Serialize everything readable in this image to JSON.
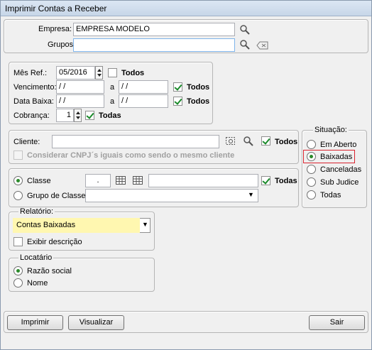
{
  "window": {
    "title": "Imprimir Contas a Receber"
  },
  "empresa": {
    "label": "Empresa:",
    "value": "EMPRESA MODELO"
  },
  "grupos": {
    "label": "Grupos:",
    "value": ""
  },
  "filters": {
    "mes_ref": {
      "label": "Mês Ref.:",
      "value": "05/2016",
      "todos_label": "Todos",
      "todos_checked": false
    },
    "vencimento": {
      "label": "Vencimento:",
      "from": " / /",
      "sep": "a",
      "to": " / /",
      "todos_label": "Todos",
      "todos_checked": true
    },
    "data_baixa": {
      "label": "Data Baixa:",
      "from": " / /",
      "sep": "a",
      "to": " / /",
      "todos_label": "Todos",
      "todos_checked": true
    },
    "cobranca": {
      "label": "Cobrança:",
      "value": "1",
      "todas_label": "Todas",
      "todas_checked": true
    }
  },
  "cliente": {
    "label": "Cliente:",
    "value": "",
    "todos_label": "Todos",
    "todos_checked": true,
    "cnpj_label": "Considerar CNPJ´s iguais como sendo o mesmo cliente",
    "cnpj_checked": false
  },
  "classe": {
    "classe_label": "Classe",
    "classe_value": ".",
    "classe_desc": "",
    "todas_label": "Todas",
    "todas_checked": true,
    "grupo_label": "Grupo de Classe:",
    "grupo_value": "",
    "selected": "classe"
  },
  "relatorio": {
    "legend": "Relatório:",
    "selected": "Contas Baixadas",
    "exibir_label": "Exibir descrição",
    "exibir_checked": false
  },
  "locatario": {
    "legend": "Locatário",
    "razao_label": "Razão social",
    "nome_label": "Nome",
    "selected": "razao"
  },
  "situacao": {
    "legend": "Situação:",
    "options": [
      "Em Aberto",
      "Baixadas",
      "Canceladas",
      "Sub Judice",
      "Todas"
    ],
    "selected": "Baixadas"
  },
  "buttons": {
    "imprimir": "Imprimir",
    "visualizar": "Visualizar",
    "sair": "Sair"
  },
  "colors": {
    "highlight": "#fff7b0",
    "selection_border": "#d9232e",
    "check": "#1a8a2a"
  }
}
